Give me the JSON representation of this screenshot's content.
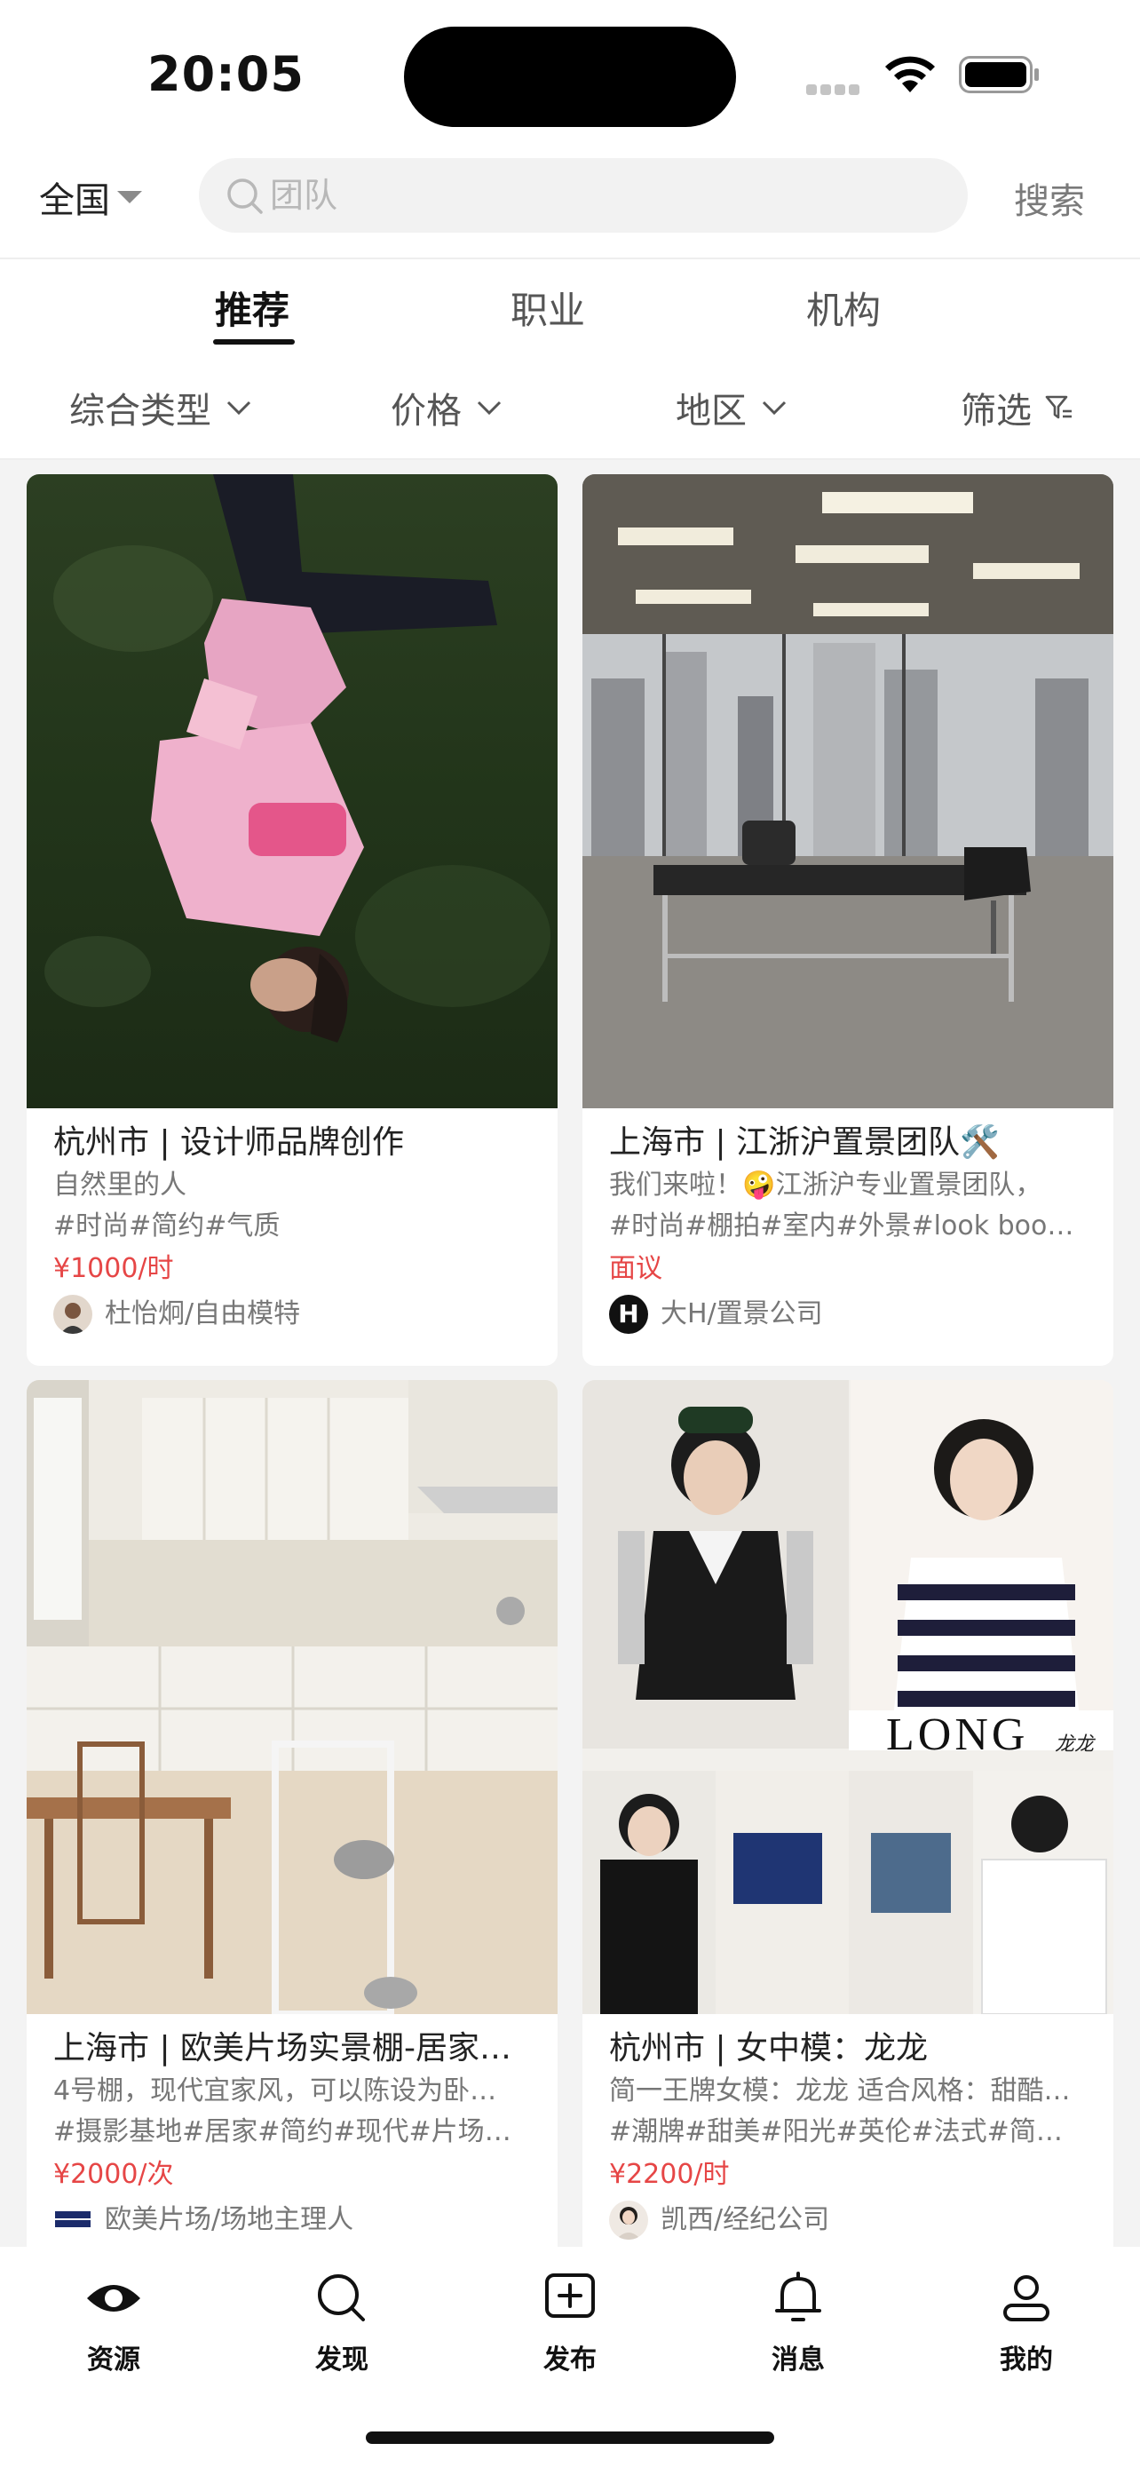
{
  "status_bar": {
    "time": "20:05"
  },
  "search": {
    "region": "全国",
    "placeholder": "团队",
    "button_label": "搜索"
  },
  "tabs": [
    {
      "label": "推荐",
      "active": true
    },
    {
      "label": "职业",
      "active": false
    },
    {
      "label": "机构",
      "active": false
    }
  ],
  "filters": [
    {
      "label": "综合类型"
    },
    {
      "label": "价格"
    },
    {
      "label": "地区"
    },
    {
      "label": "筛选"
    }
  ],
  "cards": [
    {
      "title": "杭州市 | 设计师品牌创作",
      "desc": "自然里的人",
      "tags": "#时尚#简约#气质",
      "price": "¥1000/时",
      "author": "杜怡炯/自由模特",
      "image": "photo-model-on-grass"
    },
    {
      "title": "上海市 | 江浙沪置景团队🛠️",
      "desc": "我们来啦！🤪江浙沪专业置景团队，",
      "tags": "#时尚#棚拍#室内#外景#look book#…",
      "price": "面议",
      "author": "大H/置景公司",
      "avatar_text": "H",
      "image": "photo-office-set"
    },
    {
      "title": "上海市 | 欧美片场实景棚-居家…",
      "desc": "4号棚，现代宜家风，可以陈设为卧…",
      "tags": "#摄影基地#居家#简约#现代#片场#…",
      "price": "¥2000/次",
      "author": "欧美片场/场地主理人",
      "image": "photo-kitchen-set"
    },
    {
      "title": "杭州市 | 女中模：龙龙",
      "desc": "简一王牌女模：龙龙  适合风格：甜酷…",
      "tags": "#潮牌#甜美#阳光#英伦#法式#简约#…",
      "price": "¥2200/时",
      "author": "凯西/经纪公司",
      "image": "photo-model-collage",
      "image_text": "LONG",
      "image_subtext": "龙龙"
    }
  ],
  "bottom_nav": [
    {
      "label": "资源",
      "icon": "eye-icon",
      "active": true
    },
    {
      "label": "发现",
      "icon": "search-icon",
      "active": false
    },
    {
      "label": "发布",
      "icon": "plus-square-icon",
      "active": false
    },
    {
      "label": "消息",
      "icon": "bell-icon",
      "active": false
    },
    {
      "label": "我的",
      "icon": "person-icon",
      "active": false
    }
  ],
  "colors": {
    "price": "#e64646",
    "feed_background": "#f3f3f3"
  }
}
